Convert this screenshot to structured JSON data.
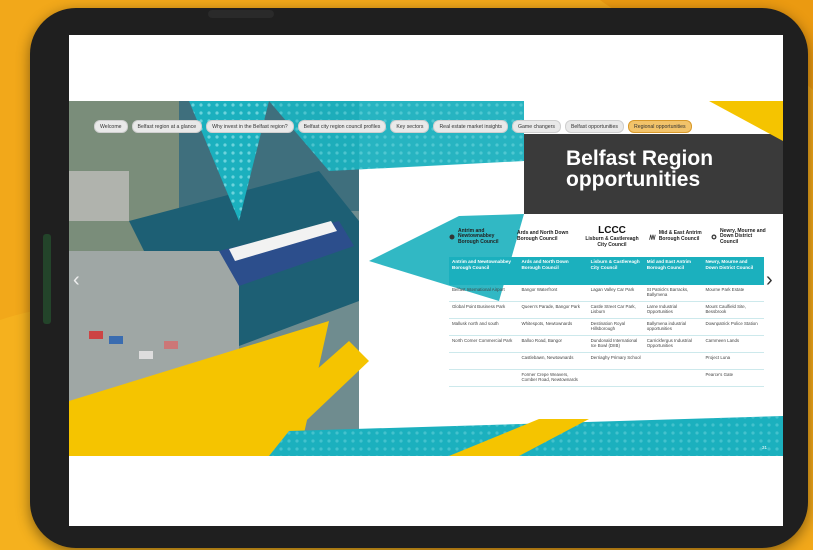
{
  "nav": {
    "items": [
      {
        "label": "Welcome",
        "active": false
      },
      {
        "label": "Belfast region at a glance",
        "active": false
      },
      {
        "label": "Why invest in the Belfast region?",
        "active": false
      },
      {
        "label": "Belfast city region council profiles",
        "active": false
      },
      {
        "label": "Key sectors",
        "active": false
      },
      {
        "label": "Real estate market insights",
        "active": false
      },
      {
        "label": "Game changers",
        "active": false
      },
      {
        "label": "Belfast opportunities",
        "active": false
      },
      {
        "label": "Regional opportunities",
        "active": true
      }
    ]
  },
  "title": {
    "line1": "Belfast Region",
    "line2": "opportunities"
  },
  "logos": [
    {
      "name": "antrim-newtownabbey-logo",
      "text": "Antrim and Newtownabbey Borough Council"
    },
    {
      "name": "ards-north-down-logo",
      "text": "Ards and North Down Borough Council"
    },
    {
      "name": "lccc-logo",
      "mark": "LCCC",
      "text": "Lisburn & Castlereagh City Council"
    },
    {
      "name": "mid-east-antrim-logo",
      "text": "Mid & East Antrim Borough Council"
    },
    {
      "name": "newry-mourne-down-logo",
      "text": "Newry, Mourne and Down District Council"
    }
  ],
  "table": {
    "headers": [
      "Antrim and Newtownabbey Borough Council",
      "Ards and North Down Borough Council",
      "Lisburn & Castlereagh City Council",
      "Mid and East Antrim Borough Council",
      "Newry, Mourne and Down District Council"
    ],
    "rows": [
      [
        "Belfast International Airport",
        "Bangor Waterfront",
        "Lagan Valley Car Park",
        "St Patrick's Barracks, Ballymena",
        "Mourne Park Estate"
      ],
      [
        "Global Point Business Park",
        "Queen's Parade, Bangor Park",
        "Castle Street Car Park, Lisburn",
        "Larne Industrial Opportunities",
        "Mount Caulfield Site, Bessbrook"
      ],
      [
        "Mallusk north and south",
        "Whitespots, Newtownards",
        "Destination Royal Hillsborough",
        "Ballymena industrial opportunities",
        "Downpatrick Police Station"
      ],
      [
        "North Corner Commercial Park",
        "Balloo Road, Bangor",
        "Dundonald International Ice Bowl (DIIB)",
        "Carrickfergus Industrial Opportunities",
        "Carnmeen Lands"
      ],
      [
        "",
        "Castlebawn, Newtownards",
        "Derriaghy Primary School",
        "",
        "Project Luna"
      ],
      [
        "",
        "Former Crepe Weavers, Comber Road, Newtownards",
        "",
        "",
        "Pearce's Gate"
      ]
    ]
  },
  "page_number": "31",
  "colors": {
    "teal": "#1bb0be",
    "yellow": "#f5c400",
    "dark": "#3a3a3a",
    "frame": "#f0a716"
  }
}
